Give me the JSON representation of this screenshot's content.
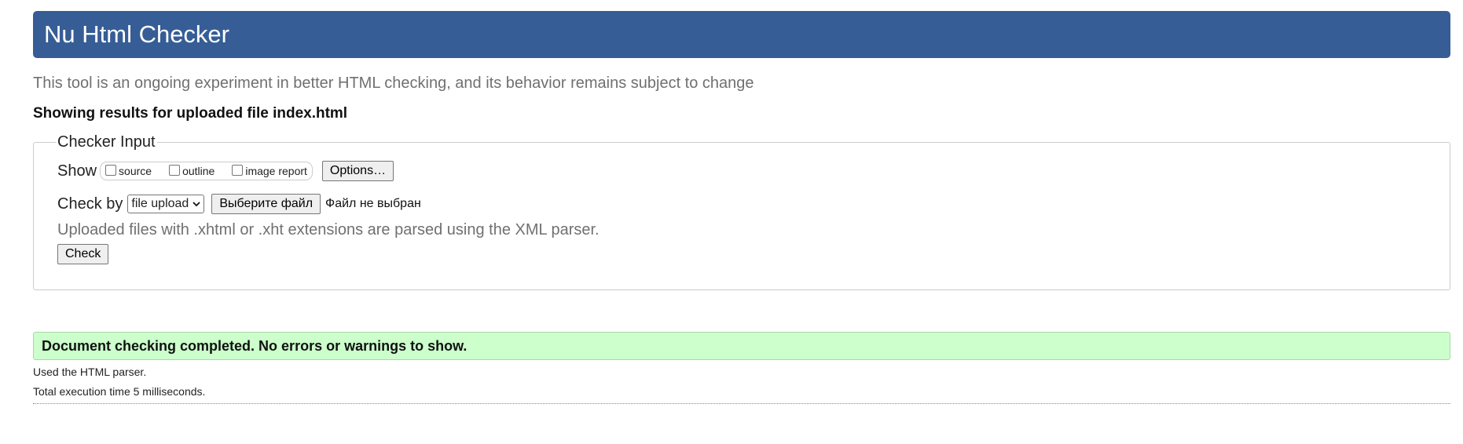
{
  "header": {
    "title": "Nu Html Checker"
  },
  "tagline": "This tool is an ongoing experiment in better HTML checking, and its behavior remains subject to change",
  "showing": "Showing results for uploaded file index.html",
  "checker": {
    "legend": "Checker Input",
    "show_label": "Show",
    "show_options": [
      {
        "label": "source",
        "checked": false
      },
      {
        "label": "outline",
        "checked": false
      },
      {
        "label": "image report",
        "checked": false
      }
    ],
    "options_button": "Options…",
    "check_by_label": "Check by",
    "check_by_value": "file upload",
    "file_button": "Выберите файл",
    "file_status": "Файл не выбран",
    "hint": "Uploaded files with .xhtml or .xht extensions are parsed using the XML parser.",
    "check_button": "Check"
  },
  "result": {
    "message": "Document checking completed. No errors or warnings to show.",
    "parser_note": "Used the HTML parser.",
    "time_note": "Total execution time 5 milliseconds."
  },
  "colors": {
    "banner": "#365d95",
    "success_bg": "#ccffcc",
    "muted_text": "#707070"
  }
}
